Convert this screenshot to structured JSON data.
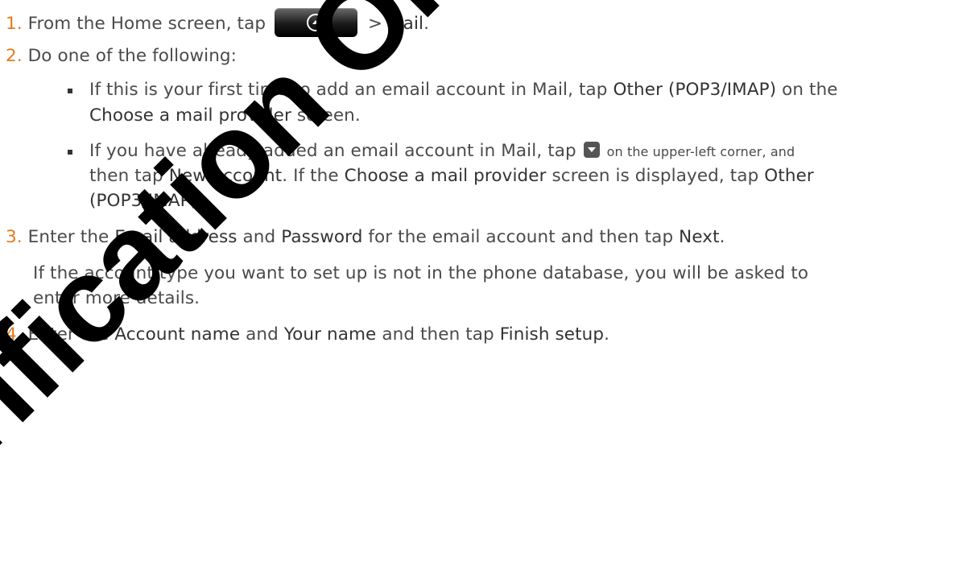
{
  "watermark": "Verification Only",
  "steps": {
    "s1": {
      "num": "1.",
      "a": "From the Home screen, tap ",
      "b": " > ",
      "mail": "Mail",
      "c": "."
    },
    "s2": {
      "num": "2.",
      "text": "Do one of the following:"
    },
    "b1": {
      "l1a": "If this is your first time to add an email account in Mail, tap ",
      "l1k": "Other (POP3/IMAP)",
      "l1b": " on the",
      "l2k": "Choose a mail provider",
      "l2b": " screen."
    },
    "b2": {
      "l1a": "If you have already added an email account in Mail, tap ",
      "l1small": "on the upper-left corner, and",
      "l2a": "then tap ",
      "l2k": "New account",
      "l2b": ". If the ",
      "l2k2": "Choose a mail provider",
      "l2c": " screen is displayed, tap ",
      "l2k3": "Other",
      "l3k": "(POP3/IMAP)",
      "l3b": "."
    },
    "s3": {
      "num": "3.",
      "a": "Enter the ",
      "k1": "Email address",
      "b": " and ",
      "k2": "Password",
      "c": " for the email account and then tap ",
      "k3": "Next",
      "d": "."
    },
    "s3note": {
      "l1": "If the account type you want to set up is not in the phone database, you will be asked to",
      "l2": "enter more details."
    },
    "s4": {
      "num": "4.",
      "a": "Enter the ",
      "k1": "Account name",
      "b": " and ",
      "k2": "Your name",
      "c": " and then tap ",
      "k3": "Finish setup",
      "d": "."
    }
  },
  "icons": {
    "home_button": "all-apps-button-icon",
    "dropdown": "dropdown-arrow-icon"
  },
  "colors": {
    "step_number": "#e47a1b",
    "body_text": "#4a4a4a"
  }
}
